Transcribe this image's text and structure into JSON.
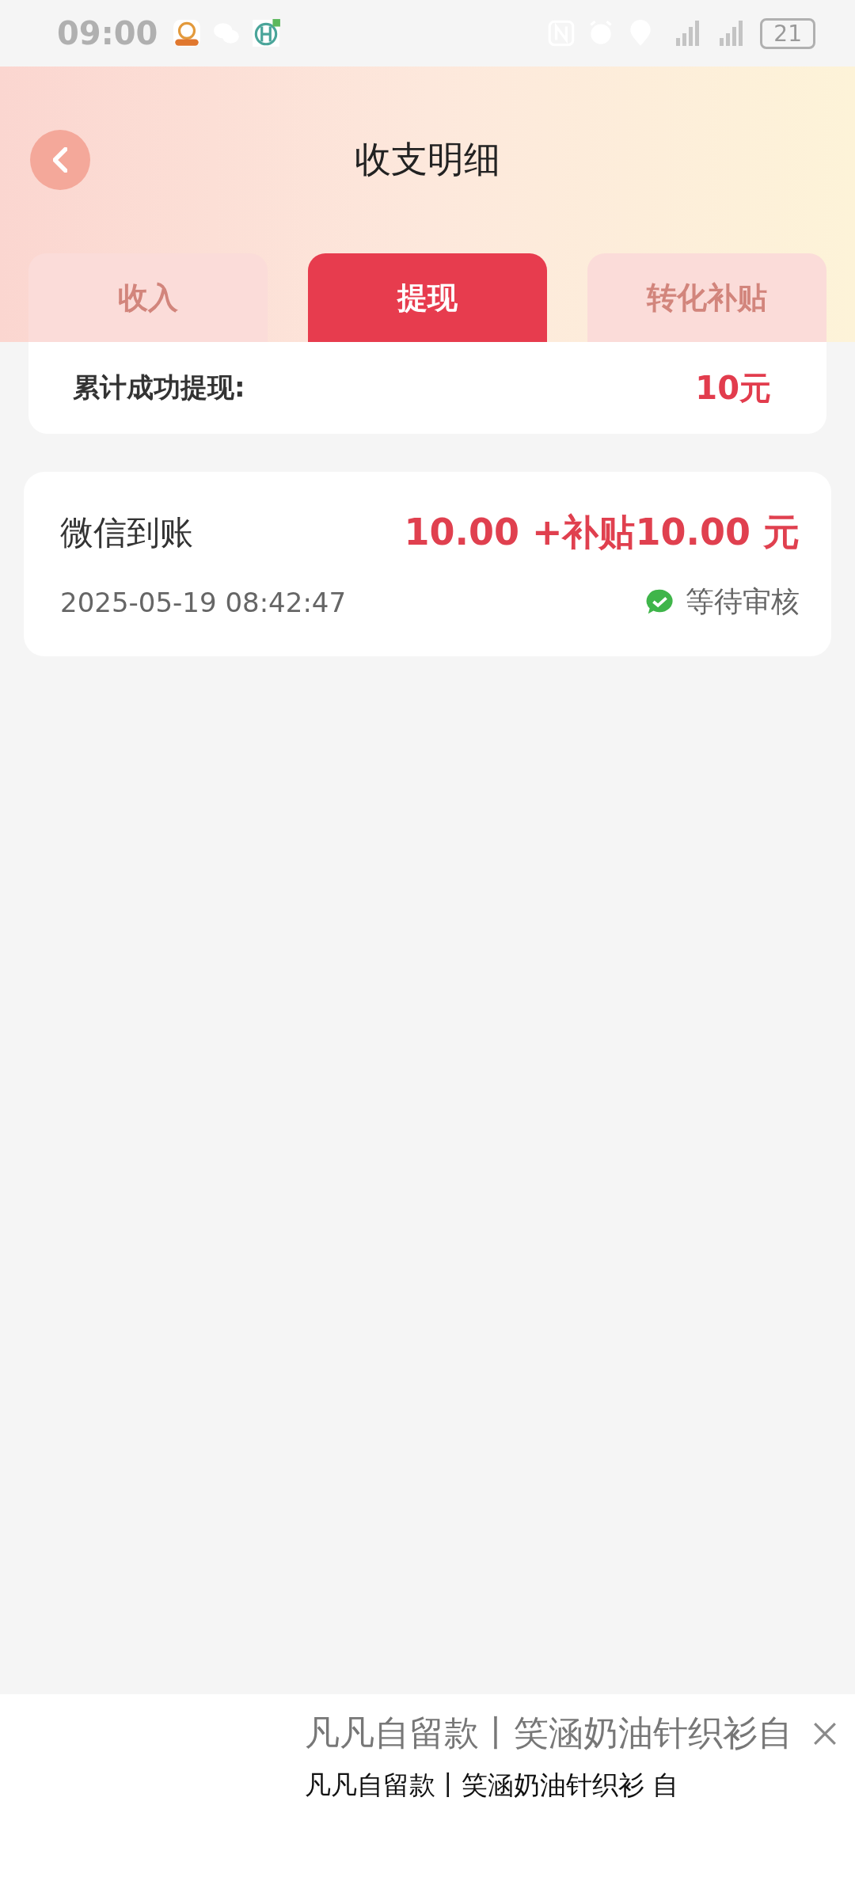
{
  "status_bar": {
    "time": "09:00",
    "battery": "21"
  },
  "header": {
    "title": "收支明细"
  },
  "tabs": [
    {
      "label": "收入",
      "selected": false
    },
    {
      "label": "提现",
      "selected": true
    },
    {
      "label": "转化补贴",
      "selected": false
    }
  ],
  "summary": {
    "label": "累计成功提现:",
    "value": "10元"
  },
  "records": [
    {
      "title": "微信到账",
      "amount": "10.00 +补贴10.00 元",
      "time": "2025-05-19 08:42:47",
      "status": "等待审核"
    }
  ],
  "ad_banner": {
    "headline": "凡凡自留款丨笑涵奶油针织衫自",
    "caption": "凡凡自留款丨笑涵奶油针织衫 自"
  }
}
